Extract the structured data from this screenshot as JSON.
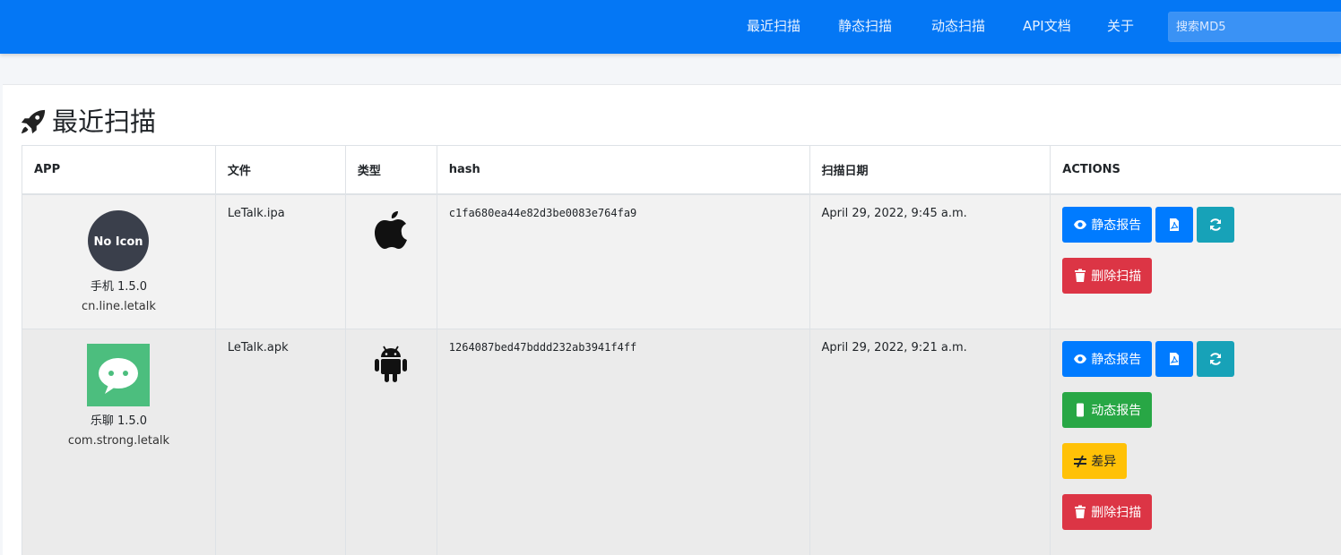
{
  "nav": {
    "links": [
      "最近扫描",
      "静态扫描",
      "动态扫描",
      "API文档",
      "关于"
    ],
    "search_placeholder": "搜索MD5"
  },
  "page": {
    "title": "最近扫描",
    "title_icon": "rocket-icon"
  },
  "table": {
    "headers": [
      "APP",
      "文件",
      "类型",
      "hash",
      "扫描日期",
      "ACTIONS"
    ],
    "rows": [
      {
        "app_icon_text": "No Icon",
        "app_name": "手机 1.5.0",
        "app_package": "cn.line.letalk",
        "file": "LeTalk.ipa",
        "type_icon": "apple-icon",
        "hash": "c1fa680ea44e82d3be0083e764fa9",
        "date": "April 29, 2022, 9:45 a.m.",
        "actions": {
          "static_report": "静态报告",
          "delete_scan": "删除扫描"
        }
      },
      {
        "app_icon_text": "",
        "app_name": "乐聊 1.5.0",
        "app_package": "com.strong.letalk",
        "file": "LeTalk.apk",
        "type_icon": "android-icon",
        "hash": "1264087bed47bddd232ab3941f4ff",
        "date": "April 29, 2022, 9:21 a.m.",
        "actions": {
          "static_report": "静态报告",
          "dynamic_report": "动态报告",
          "diff": "差异",
          "delete_scan": "删除扫描"
        }
      }
    ]
  },
  "colors": {
    "navbar": "#0477f5",
    "primary": "#007bff",
    "info": "#17a2b8",
    "danger": "#dc3545",
    "success": "#28a745",
    "warning": "#ffc107"
  }
}
